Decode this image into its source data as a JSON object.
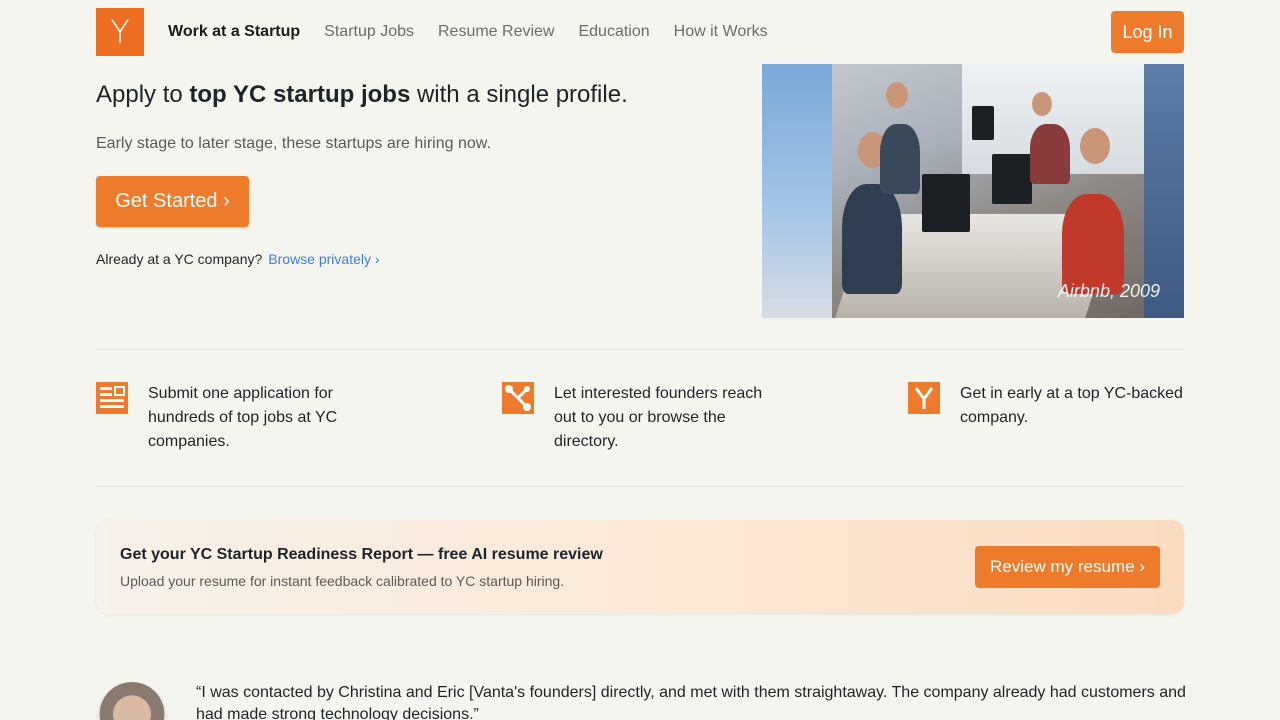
{
  "nav": {
    "logo": "Y",
    "links": [
      {
        "label": "Work at a Startup",
        "active": true
      },
      {
        "label": "Startup Jobs"
      },
      {
        "label": "Resume Review"
      },
      {
        "label": "Education"
      },
      {
        "label": "How it Works"
      }
    ],
    "login_label": "Log In"
  },
  "hero": {
    "title_pre": "Apply to ",
    "title_bold": "top YC startup jobs",
    "title_post": " with a single profile.",
    "subtitle": "Early stage to later stage, these startups are hiring now.",
    "cta_label": "Get Started ›",
    "already_text": "Already at a YC company?",
    "browse_link": "Browse privately ›",
    "photo_caption": "Airbnb, 2009"
  },
  "features": [
    {
      "icon": "application-form-icon",
      "text": "Submit one application for hundreds of top jobs at YC companies."
    },
    {
      "icon": "network-connect-icon",
      "text": "Let interested founders reach out to you or browse the directory."
    },
    {
      "icon": "yc-logo-icon",
      "text": "Get in early at a top YC-backed company."
    }
  ],
  "banner": {
    "title": "Get your YC Startup Readiness Report — free AI resume review",
    "subtitle": "Upload your resume for instant feedback calibrated to YC startup hiring.",
    "button_label": "Review my resume ›"
  },
  "testimonial": {
    "quote": "“I was contacted by Christina and Eric [Vanta's founders] directly, and met with them straightaway. The company already had customers and had made strong technology decisions.”"
  },
  "colors": {
    "accent": "#ee7a2b",
    "background": "#f5f5ef",
    "link": "#3b7ddd"
  }
}
